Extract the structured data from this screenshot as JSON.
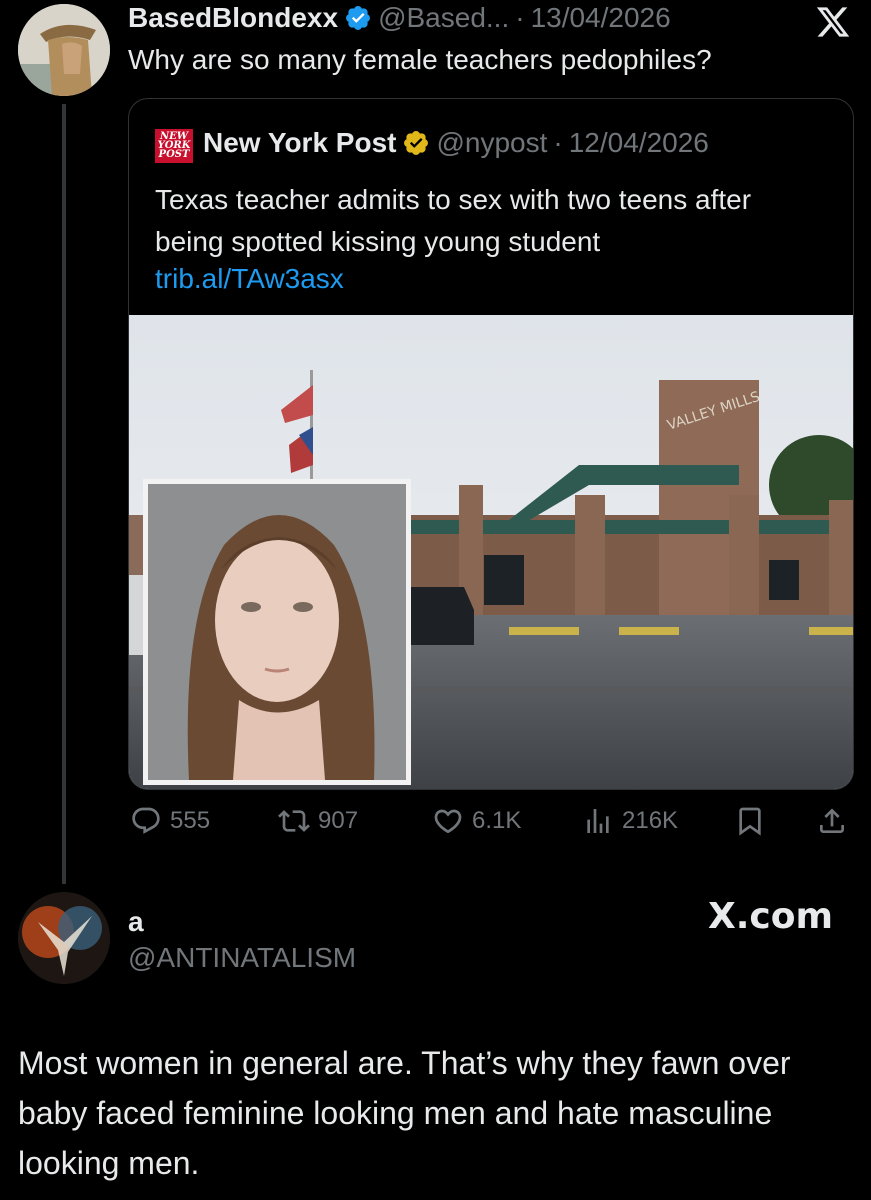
{
  "tweet": {
    "author_name": "BasedBlondexx",
    "handle": "@Based...",
    "separator": "·",
    "date": "13/04/2026",
    "text": "Why are so many female teachers pedophiles?"
  },
  "quote": {
    "logo_text": "NEW YORK POST",
    "author_name": "New York Post",
    "handle": "@nypost",
    "separator": "·",
    "date": "12/04/2026",
    "text": "Texas teacher admits to sex with two teens after being spotted kissing young student",
    "link": "trib.al/TAw3asx",
    "building_sign": "VALLEY MILLS"
  },
  "actions": {
    "replies": "555",
    "reposts": "907",
    "likes": "6.1K",
    "views": "216K"
  },
  "reply": {
    "author_name": "a",
    "handle": "@ANTINATALISM",
    "watermark": "X.com",
    "text": "Most women in general are. That’s why they fawn over baby faced feminine looking men and hate masculine looking men."
  },
  "colors": {
    "background": "#000000",
    "text": "#e7e9ea",
    "muted": "#71767b",
    "link": "#1d9bf0",
    "verified_blue": "#1d9bf0",
    "verified_gold": "#e2b719",
    "nyp_red": "#c8102e"
  },
  "icons": [
    "x-logo-icon",
    "verified-badge-icon",
    "gold-verified-badge-icon",
    "reply-icon",
    "repost-icon",
    "like-icon",
    "views-icon",
    "bookmark-icon",
    "share-icon"
  ]
}
